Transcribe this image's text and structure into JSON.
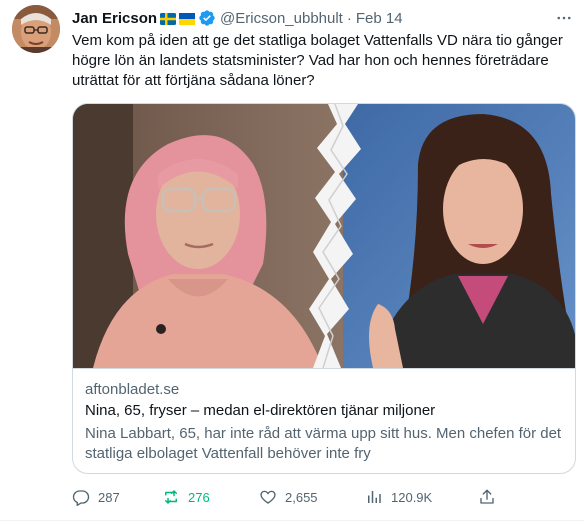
{
  "tweet": {
    "author_name": "Jan Ericson",
    "author_handle": "@Ericson_ubbhult",
    "separator": "·",
    "date": "Feb 14",
    "text": "Vem kom på iden att ge det statliga bolaget Vattenfalls VD nära tio gånger högre lön än landets statsminister? Vad har hon och hennes företrädare uträttat för att förtjäna sådana löner?",
    "icons": {
      "flags": [
        "sweden-flag-icon",
        "ukraine-flag-icon"
      ],
      "verified": "verified-badge-icon",
      "more": "more-options-icon"
    }
  },
  "card": {
    "domain": "aftonbladet.se",
    "title": "Nina, 65, fryser – medan el-direktören tjänar miljoner",
    "description": "Nina Labbart, 65, har inte råd att värma upp sitt hus. Men chefen för det statliga elbolaget Vattenfall behöver inte fry"
  },
  "actions": {
    "reply_count": "287",
    "retweet_count": "276",
    "like_count": "2,655",
    "view_count": "120.9K",
    "icons": [
      "reply-icon",
      "retweet-icon",
      "like-icon",
      "views-icon",
      "share-icon"
    ]
  },
  "colors": {
    "text": "#0f1419",
    "secondary": "#536471",
    "retweet_active": "#00ba7c",
    "verified_blue": "#1d9bf0",
    "border": "#cfd9de"
  }
}
